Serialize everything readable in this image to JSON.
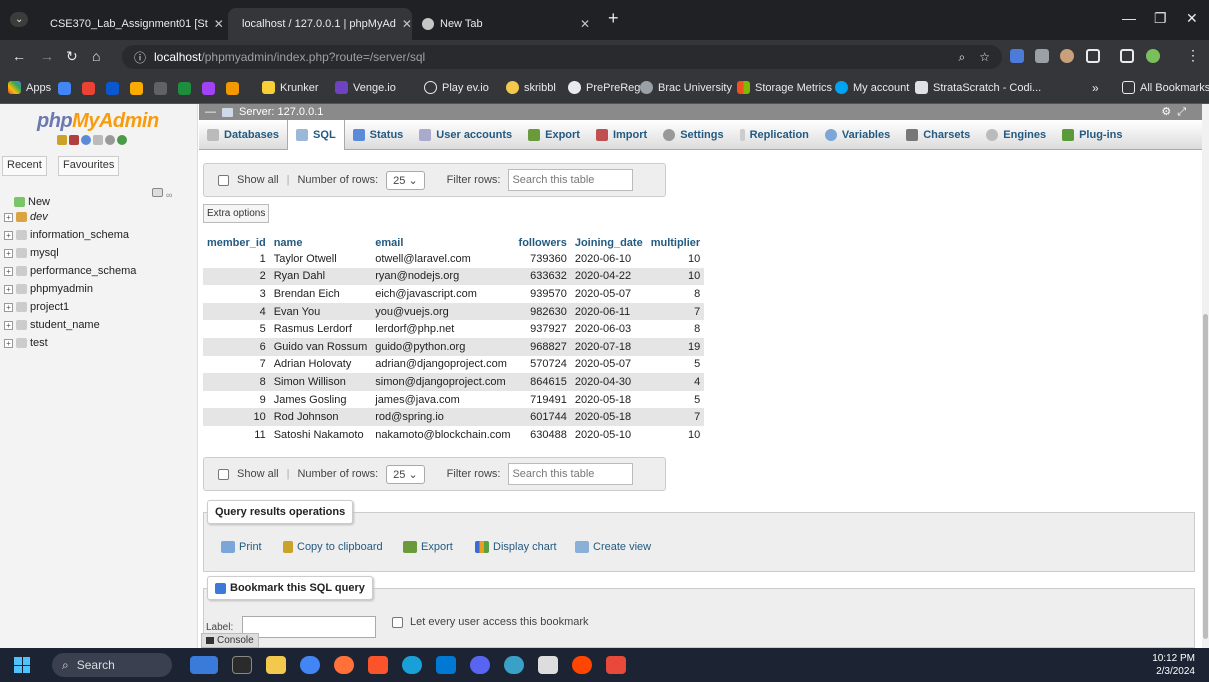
{
  "browser": {
    "tabs": [
      {
        "title": "CSE370_Lab_Assignment01 [St",
        "active": false
      },
      {
        "title": "localhost / 127.0.0.1 | phpMyAd",
        "active": true
      },
      {
        "title": "New Tab",
        "active": false
      }
    ],
    "url_host": "localhost",
    "url_path": "/phpmyadmin/index.php?route=/server/sql",
    "bookmarks": [
      "Apps",
      "Krunker",
      "Venge.io",
      "Play ev.io",
      "skribbl",
      "PrePreReg",
      "Brac University",
      "Storage Metrics",
      "My account",
      "StrataScratch - Codi...",
      "All Bookmarks"
    ]
  },
  "pma": {
    "logo_a": "php",
    "logo_b": "MyAdmin",
    "recent_label": "Recent",
    "favourites_label": "Favourites",
    "tree": [
      "New",
      "dev",
      "information_schema",
      "mysql",
      "performance_schema",
      "phpmyadmin",
      "project1",
      "student_name",
      "test"
    ],
    "server_label": "Server: 127.0.0.1",
    "menu": [
      "Databases",
      "SQL",
      "Status",
      "User accounts",
      "Export",
      "Import",
      "Settings",
      "Replication",
      "Variables",
      "Charsets",
      "Engines",
      "Plug-ins"
    ],
    "nav": {
      "show_all": "Show all",
      "rows_label": "Number of rows:",
      "rows_value": "25",
      "filter_label": "Filter rows:",
      "filter_placeholder": "Search this table"
    },
    "extra_options": "Extra options",
    "columns": [
      "member_id",
      "name",
      "email",
      "followers",
      "Joining_date",
      "multiplier"
    ],
    "rows": [
      [
        "1",
        "Taylor Otwell",
        "otwell@laravel.com",
        "739360",
        "2020-06-10",
        "10"
      ],
      [
        "2",
        "Ryan Dahl",
        "ryan@nodejs.org",
        "633632",
        "2020-04-22",
        "10"
      ],
      [
        "3",
        "Brendan Eich",
        "eich@javascript.com",
        "939570",
        "2020-05-07",
        "8"
      ],
      [
        "4",
        "Evan You",
        "you@vuejs.org",
        "982630",
        "2020-06-11",
        "7"
      ],
      [
        "5",
        "Rasmus Lerdorf",
        "lerdorf@php.net",
        "937927",
        "2020-06-03",
        "8"
      ],
      [
        "6",
        "Guido van Rossum",
        "guido@python.org",
        "968827",
        "2020-07-18",
        "19"
      ],
      [
        "7",
        "Adrian Holovaty",
        "adrian@djangoproject.com",
        "570724",
        "2020-05-07",
        "5"
      ],
      [
        "8",
        "Simon Willison",
        "simon@djangoproject.com",
        "864615",
        "2020-04-30",
        "4"
      ],
      [
        "9",
        "James Gosling",
        "james@java.com",
        "719491",
        "2020-05-18",
        "5"
      ],
      [
        "10",
        "Rod Johnson",
        "rod@spring.io",
        "601744",
        "2020-05-18",
        "7"
      ],
      [
        "11",
        "Satoshi Nakamoto",
        "nakamoto@blockchain.com",
        "630488",
        "2020-05-10",
        "10"
      ]
    ],
    "query_ops_title": "Query results operations",
    "ops": [
      "Print",
      "Copy to clipboard",
      "Export",
      "Display chart",
      "Create view"
    ],
    "bookmark_title": "Bookmark this SQL query",
    "label_text": "Label:",
    "bookmark_check": "Let every user access this bookmark",
    "console": "Console"
  },
  "taskbar": {
    "search": "Search",
    "time": "10:12 PM",
    "date": "2/3/2024"
  }
}
